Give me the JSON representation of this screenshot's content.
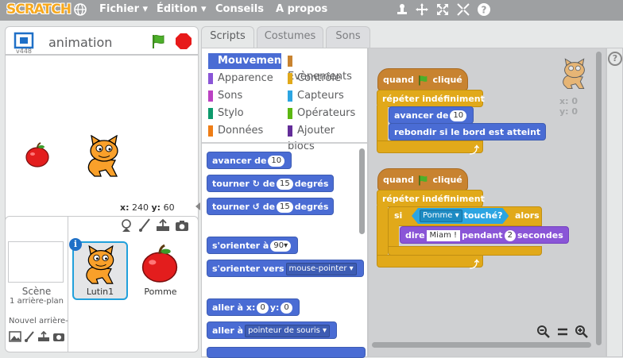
{
  "app": {
    "logo": "SCRATCH"
  },
  "menu": {
    "file": "Fichier ▾",
    "edit": "Édition ▾",
    "tips": "Conseils",
    "about": "A propos"
  },
  "stage": {
    "version": "v448",
    "sprite_name": "animation",
    "x_label": "x:",
    "x_value": "240",
    "y_label": "y:",
    "y_value": "60"
  },
  "sprites": {
    "scene_label": "Scène",
    "scene_backdrops": "1 arrière-plan",
    "new_backdrop": "Nouvel arrière-",
    "list": [
      {
        "name": "Lutin1"
      },
      {
        "name": "Pomme"
      }
    ]
  },
  "tabs": [
    {
      "label": "Scripts"
    },
    {
      "label": "Costumes"
    },
    {
      "label": "Sons"
    }
  ],
  "categories": [
    {
      "label": "Mouvement",
      "color": "#4a6cd4"
    },
    {
      "label": "Evènements",
      "color": "#c88330"
    },
    {
      "label": "Apparence",
      "color": "#8a55d7"
    },
    {
      "label": "Contrôle",
      "color": "#e1a91a"
    },
    {
      "label": "Sons",
      "color": "#bb42c3"
    },
    {
      "label": "Capteurs",
      "color": "#2ca5e2"
    },
    {
      "label": "Stylo",
      "color": "#0e9a6c"
    },
    {
      "label": "Opérateurs",
      "color": "#5cb712"
    },
    {
      "label": "Données",
      "color": "#ee7d16"
    },
    {
      "label": "Ajouter blocs",
      "color": "#632d99"
    }
  ],
  "palette": {
    "move_a": "avancer de",
    "move_v": "10",
    "turn_r_a": "tourner",
    "turn_r_b": "de",
    "turn_r_v": "15",
    "turn_r_c": "degrés",
    "turn_l_a": "tourner",
    "turn_l_b": "de",
    "turn_l_v": "15",
    "turn_l_c": "degrés",
    "point_a": "s'orienter à",
    "point_v": "90▾",
    "toward_a": "s'orienter vers",
    "toward_v": "mouse-pointer ▾",
    "goto_a": "aller à x:",
    "goto_x": "0",
    "goto_b": "y:",
    "goto_y": "0",
    "goto2_a": "aller à",
    "goto2_v": "pointeur de souris ▾"
  },
  "scripts": {
    "when_a": "quand",
    "when_b": "cliqué",
    "forever": "répéter indéfiniment",
    "move_a": "avancer de",
    "move_v": "10",
    "bounce": "rebondir si le bord est atteint",
    "when2_a": "quand",
    "when2_b": "cliqué",
    "forever2": "répéter indéfiniment",
    "if_a": "si",
    "touch_v": "Pomme ▾",
    "touch_b": "touché?",
    "if_b": "alors",
    "say_a": "dire",
    "say_v": "Miam !",
    "say_b": "pendant",
    "say_n": "2",
    "say_c": "secondes"
  },
  "sprite_info": {
    "x": "x: 0",
    "y": "y: 0"
  }
}
